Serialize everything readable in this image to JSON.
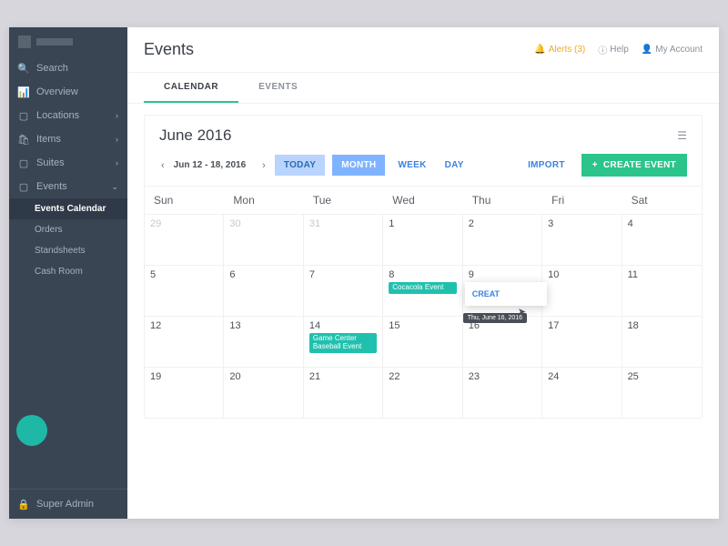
{
  "sidebar": {
    "search": "Search",
    "items": [
      {
        "icon": "📊",
        "label": "Overview",
        "chev": ""
      },
      {
        "icon": "▢",
        "label": "Locations",
        "chev": "›"
      },
      {
        "icon": "🛍",
        "label": "Items",
        "chev": "›"
      },
      {
        "icon": "▢",
        "label": "Suites",
        "chev": "›"
      },
      {
        "icon": "▢",
        "label": "Events",
        "chev": "⌄"
      }
    ],
    "subs": [
      "Events Calendar",
      "Orders",
      "Standsheets",
      "Cash Room"
    ],
    "footer": "Super Admin"
  },
  "header": {
    "title": "Events",
    "alerts_label": "Alerts (3)",
    "help": "Help",
    "account": "My Account"
  },
  "tabs": {
    "calendar": "CALENDAR",
    "events": "EVENTS"
  },
  "calendar": {
    "month_title": "June 2016",
    "range": "Jun 12 - 18, 2016",
    "today": "TODAY",
    "month": "MONTH",
    "week": "WEEK",
    "day": "DAY",
    "import": "IMPORT",
    "create": "CREATE EVENT",
    "dows": [
      "Sun",
      "Mon",
      "Tue",
      "Wed",
      "Thu",
      "Fri",
      "Sat"
    ],
    "weeks": [
      [
        {
          "n": "29",
          "o": true
        },
        {
          "n": "30",
          "o": true
        },
        {
          "n": "31",
          "o": true
        },
        {
          "n": "1"
        },
        {
          "n": "2"
        },
        {
          "n": "3"
        },
        {
          "n": "4"
        }
      ],
      [
        {
          "n": "5"
        },
        {
          "n": "6"
        },
        {
          "n": "7"
        },
        {
          "n": "8",
          "ev": "Cocacola Event"
        },
        {
          "n": "9",
          "pop": true
        },
        {
          "n": "10"
        },
        {
          "n": "11"
        }
      ],
      [
        {
          "n": "12"
        },
        {
          "n": "13"
        },
        {
          "n": "14",
          "ev": "Game Center Baseball Event"
        },
        {
          "n": "15"
        },
        {
          "n": "16",
          "tip": "Thu, June 16, 2016"
        },
        {
          "n": "17"
        },
        {
          "n": "18"
        }
      ],
      [
        {
          "n": "19"
        },
        {
          "n": "20"
        },
        {
          "n": "21"
        },
        {
          "n": "22"
        },
        {
          "n": "23"
        },
        {
          "n": "24"
        },
        {
          "n": "25"
        }
      ]
    ],
    "popover_link": "CREAT"
  }
}
